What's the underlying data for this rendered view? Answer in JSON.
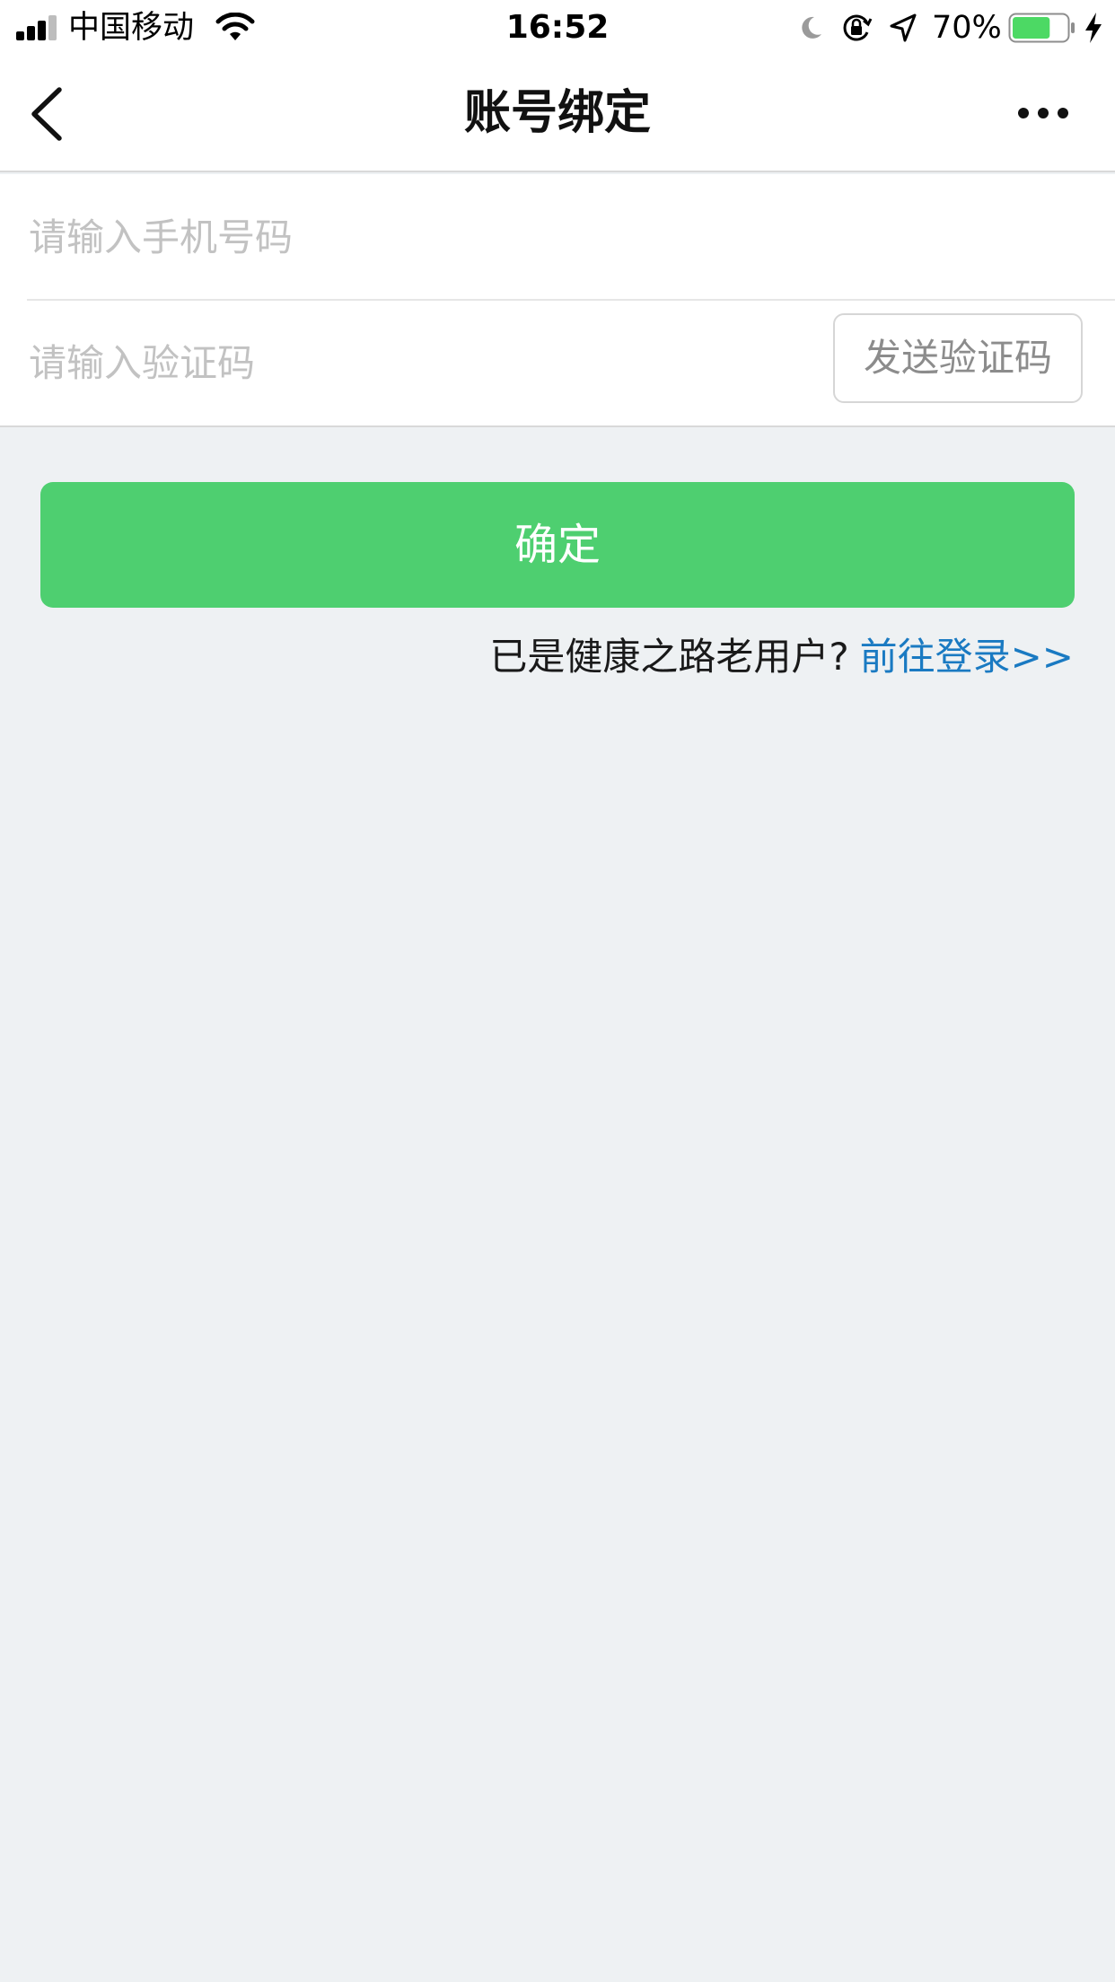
{
  "status_bar": {
    "carrier": "中国移动",
    "time": "16:52",
    "battery_percent": "70%",
    "battery_level": 0.7,
    "signal_bars": 4,
    "signal_active_bars": 3,
    "icons": [
      "signal-icon",
      "wifi-icon",
      "moon-icon",
      "orientation-lock-icon",
      "location-icon",
      "battery-icon",
      "charging-icon"
    ]
  },
  "nav": {
    "title": "账号绑定",
    "back_icon": "chevron-left-icon",
    "more_icon": "more-dots-icon"
  },
  "form": {
    "phone_placeholder": "请输入手机号码",
    "phone_value": "",
    "code_placeholder": "请输入验证码",
    "code_value": "",
    "send_code_label": "发送验证码"
  },
  "actions": {
    "confirm_label": "确定"
  },
  "login_hint": {
    "text": "已是健康之路老用户?",
    "link": "前往登录>>"
  },
  "colors": {
    "primary_green": "#4ecf70",
    "link_blue": "#1a7ac2",
    "background": "#eef1f3",
    "battery_green": "#4cd964"
  }
}
